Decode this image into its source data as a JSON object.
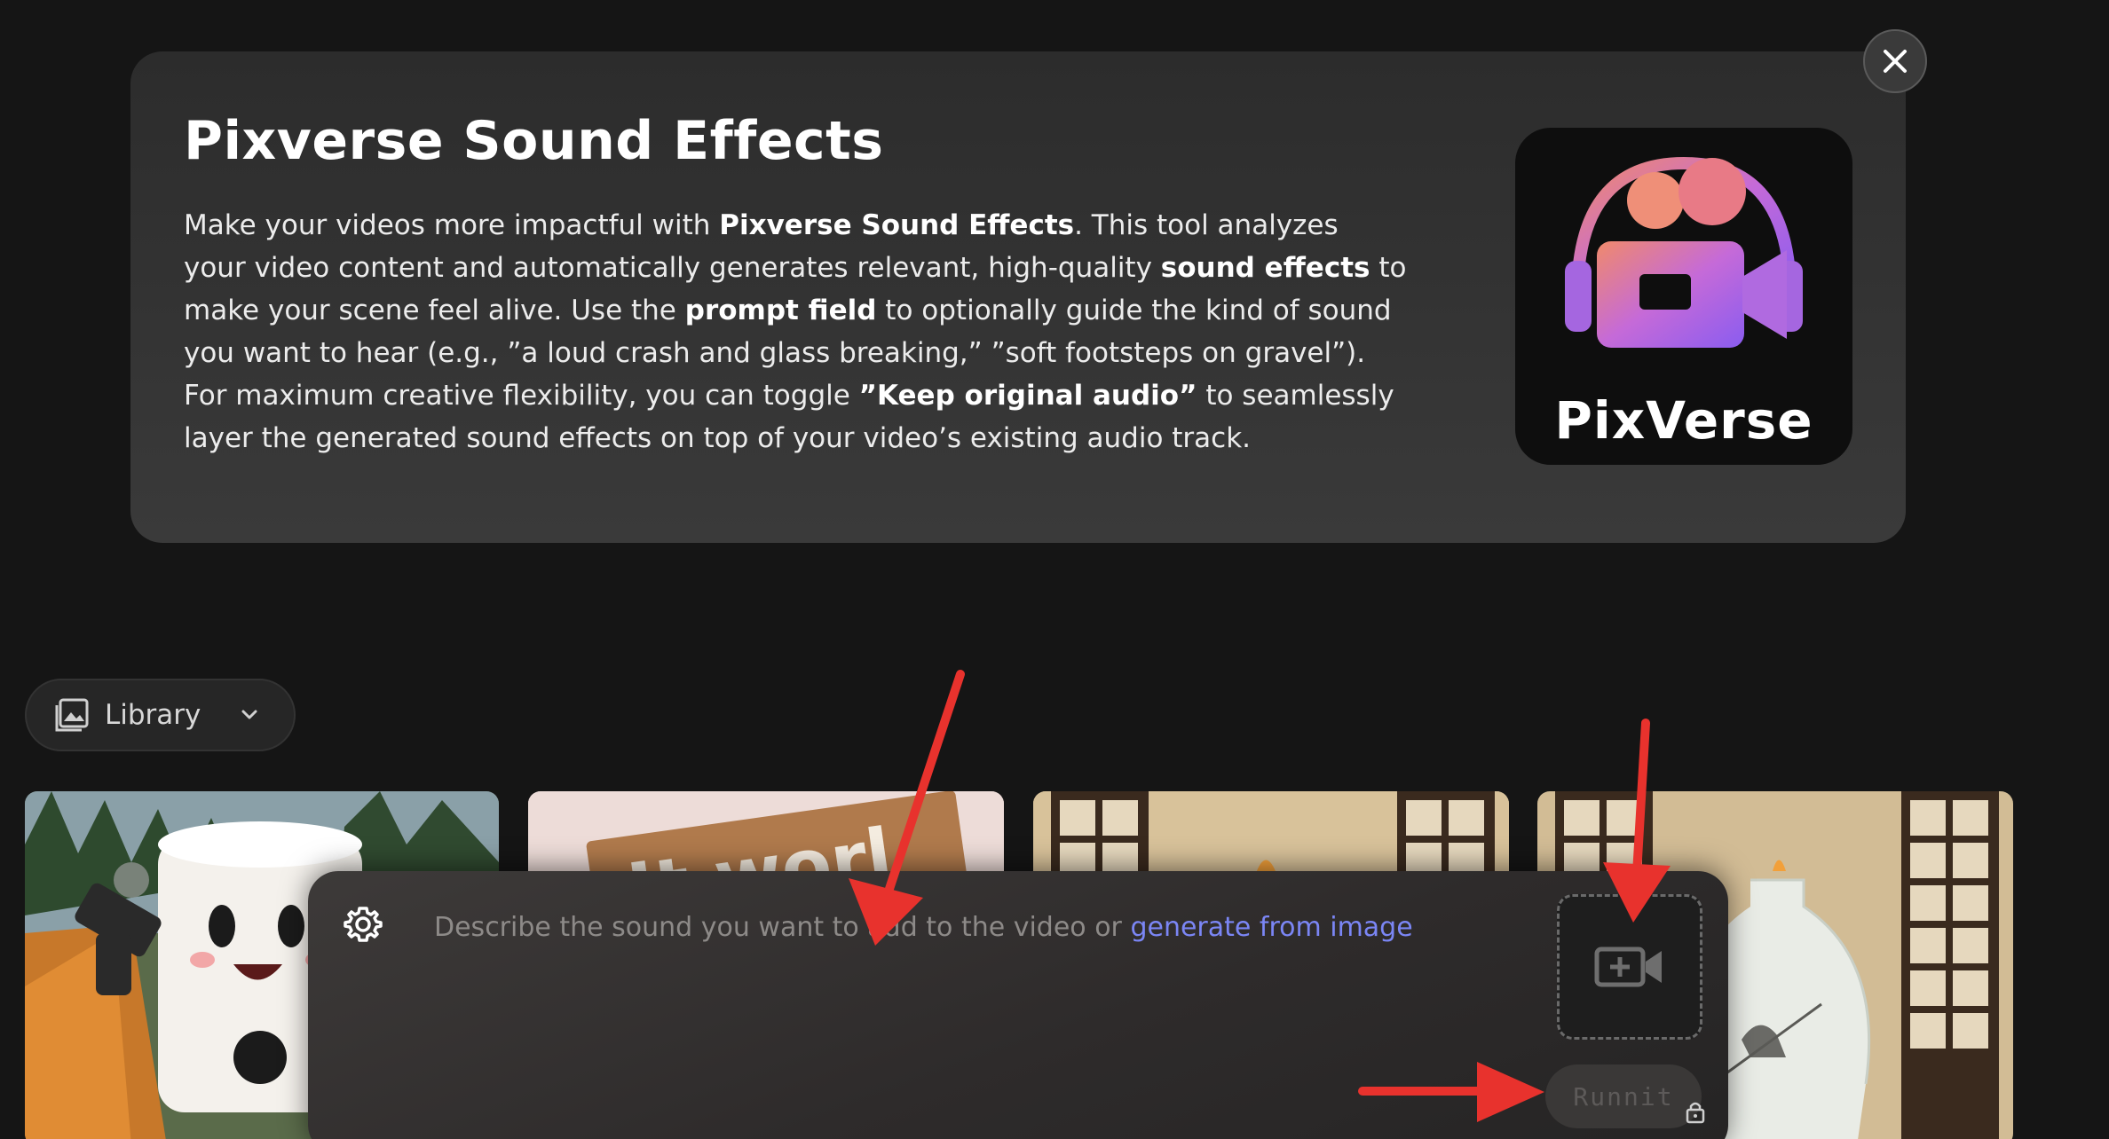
{
  "dialog": {
    "title": "Pixverse Sound Effects",
    "description": {
      "p1": "Make your videos more impactful with ",
      "b1": "Pixverse Sound Effects",
      "p2": ". This tool analyzes your video content and automatically generates relevant, high-quality ",
      "b2": "sound effects",
      "p3": " to make your scene feel alive. Use the ",
      "b3": "prompt field",
      "p4": " to optionally guide the kind of sound you want to hear (e.g., ”a loud crash and glass breaking,” ”soft footsteps on gravel”). For maximum creative flexibility, you can toggle ",
      "b4": "”Keep original audio”",
      "p5": " to seamlessly layer the generated sound effects on top of your video’s existing audio track."
    },
    "logo_text": "PixVerse",
    "close_icon": "close-icon"
  },
  "library": {
    "label": "Library",
    "icon": "image-gallery-icon",
    "chevron": "chevron-down-icon"
  },
  "gallery": {
    "thumb2_text": "It worl"
  },
  "prompt": {
    "placeholder": "Describe the sound you want to add to the video or ",
    "link": "generate from image",
    "run_label": "Runnit",
    "settings_icon": "gear-icon",
    "upload_icon": "video-add-icon",
    "lock_icon": "lock-icon"
  },
  "colors": {
    "link": "#7b86f5",
    "annotation_arrow": "#e8322d",
    "panel_bg": "#2c2c2c"
  }
}
